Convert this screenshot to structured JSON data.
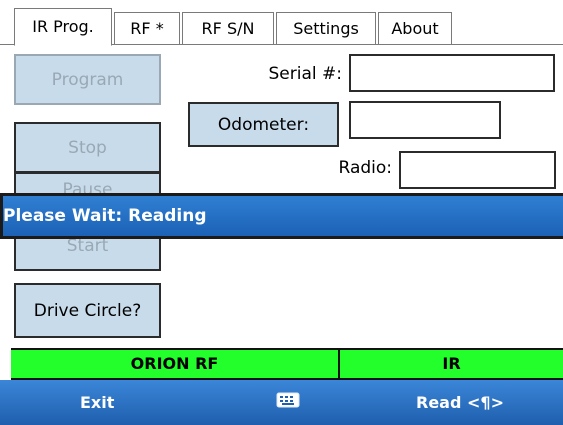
{
  "tabs": [
    {
      "label": "IR Prog."
    },
    {
      "label": "RF *"
    },
    {
      "label": "RF S/N"
    },
    {
      "label": "Settings"
    },
    {
      "label": "About"
    }
  ],
  "buttons": {
    "program": "Program",
    "stop": "Stop",
    "pause": "Pause",
    "start": "Start",
    "drive_circle": "Drive Circle?",
    "odometer": "Odometer:"
  },
  "labels": {
    "serial": "Serial #:",
    "radio": "Radio:"
  },
  "fields": {
    "serial": "",
    "odometer": "",
    "radio": ""
  },
  "progress": {
    "text": "Please Wait: Reading"
  },
  "status": {
    "left": "ORION RF",
    "right": "IR"
  },
  "softkeys": {
    "left": "Exit",
    "center_icon": "keyboard-icon",
    "right": "Read <¶>"
  },
  "colors": {
    "status_green": "#22ff2a",
    "banner_blue": "#1c62b6",
    "button_fill": "#c8dbea"
  }
}
